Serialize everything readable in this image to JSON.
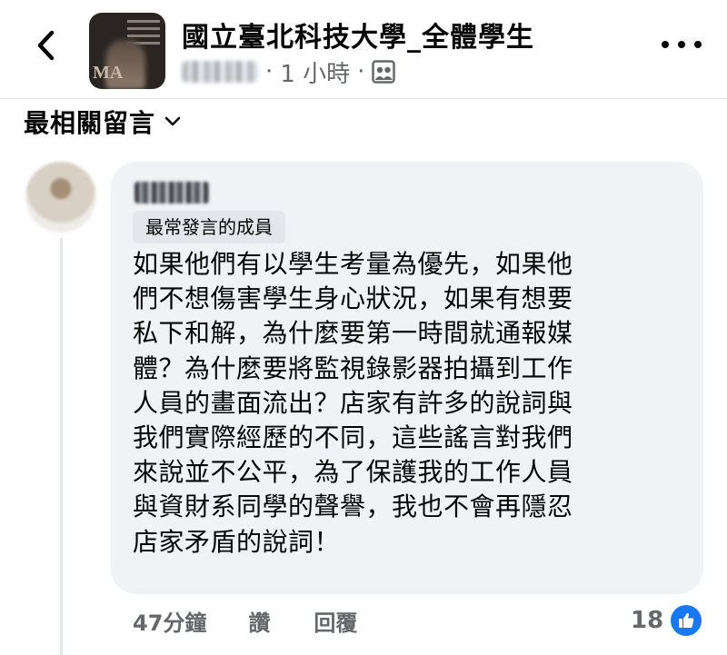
{
  "header": {
    "group_title": "國立臺北科技大學_全體學生",
    "author_name_blurred": "",
    "separator_1": "·",
    "post_time": "1 小時",
    "separator_2": "·",
    "privacy_icon": "group-icon",
    "back_icon": "chevron-left-icon",
    "more_icon": "more-dots-icon",
    "group_avatar_text": "MA"
  },
  "sort": {
    "label": "最相關留言",
    "icon": "chevron-down-icon"
  },
  "comment": {
    "badge": "最常發言的成員",
    "text": "如果他們有以學生考量為優先，如果他\n們不想傷害學生身心狀況，如果有想要\n私下和解，為什麼要第一時間就通報媒\n體？為什麼要將監視錄影器拍攝到工作\n人員的畫面流出？店家有許多的說詞與\n我們實際經歷的不同，這些謠言對我們\n來說並不公平，為了保護我的工作人員\n與資財系同學的聲譽，我也不會再隱忍\n店家矛盾的說詞！",
    "time": "47分鐘",
    "like_label": "讚",
    "reply_label": "回覆",
    "reaction_count": "18",
    "reaction_icon": "like-thumb-icon"
  },
  "colors": {
    "bubble": "#f0f2f5",
    "secondary_text": "#65676b",
    "like_blue": "#1877f2"
  }
}
